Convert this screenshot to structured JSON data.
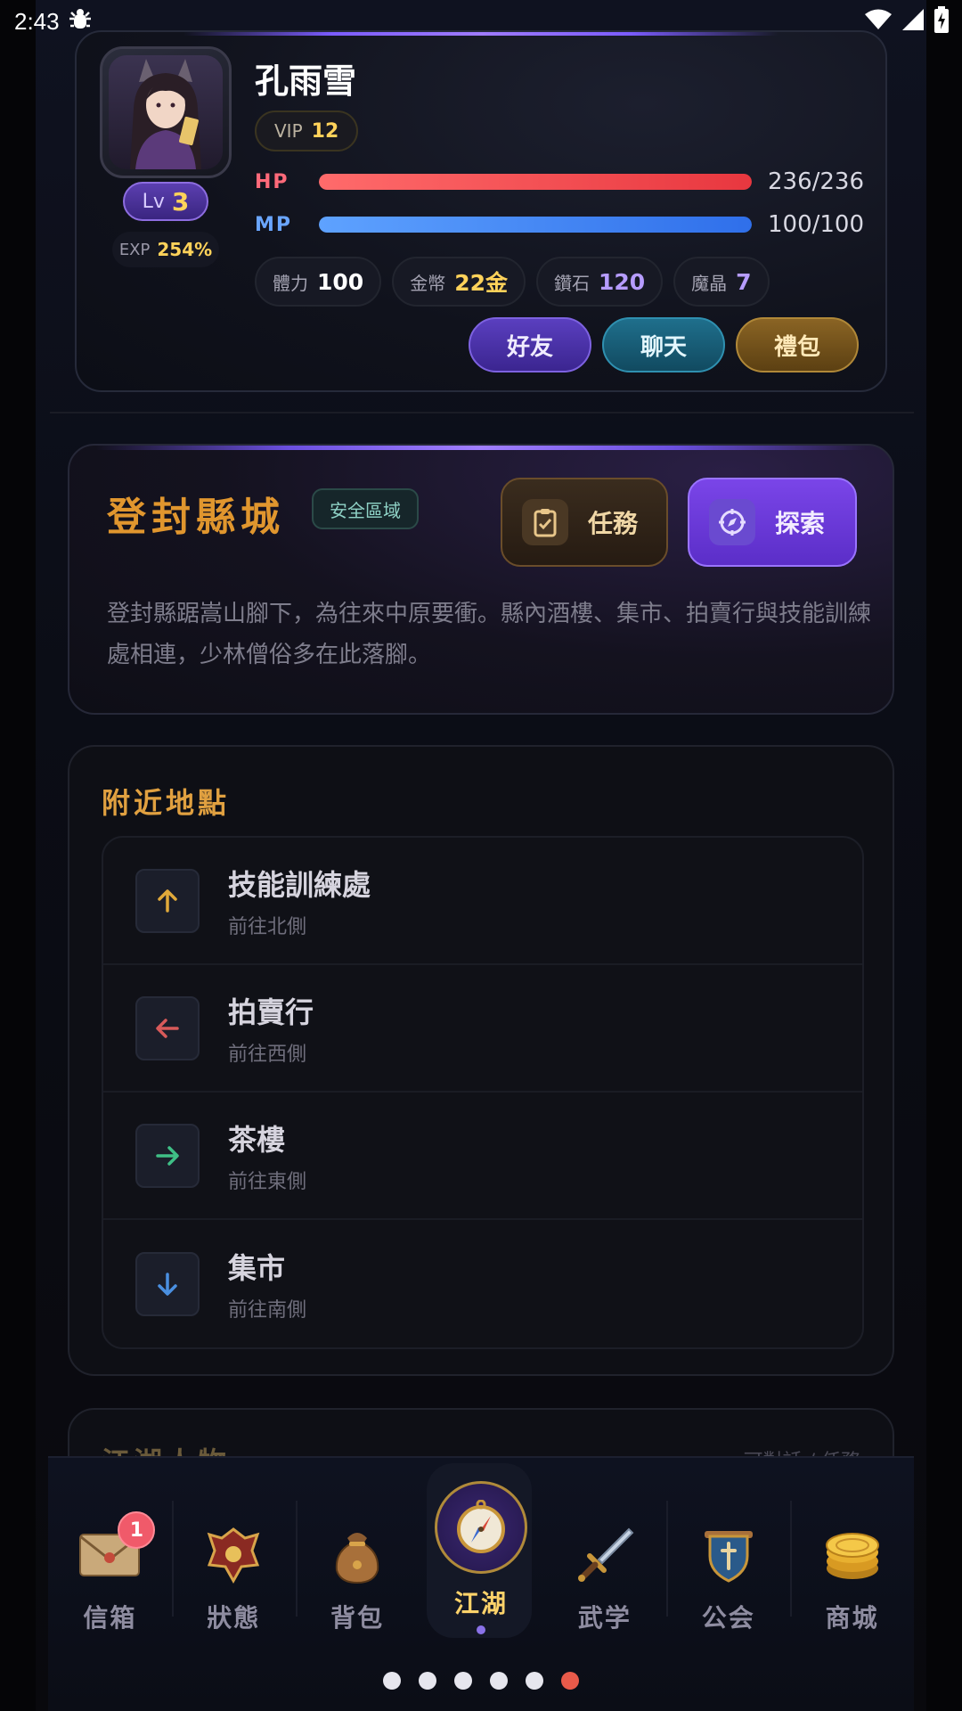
{
  "status_bar": {
    "time": "2:43"
  },
  "profile": {
    "name": "孔雨雪",
    "vip_label": "VIP",
    "vip_level": "12",
    "level_label": "Lv",
    "level": "3",
    "exp_label": "EXP",
    "exp_value": "254%",
    "hp": {
      "label": "HP",
      "value": "236/236",
      "fraction": 1.0,
      "color": "#e8373f"
    },
    "mp": {
      "label": "MP",
      "value": "100/100",
      "fraction": 1.0,
      "color": "#2f6fea"
    },
    "stats": [
      {
        "label": "體力",
        "value": "100",
        "color": "#ffffff"
      },
      {
        "label": "金幣",
        "value": "22金",
        "color": "#ffd25a"
      },
      {
        "label": "鑽石",
        "value": "120",
        "color": "#b69cff"
      },
      {
        "label": "魔晶",
        "value": "7",
        "color": "#b69cff"
      }
    ],
    "actions": {
      "friend": "好友",
      "chat": "聊天",
      "gift": "禮包"
    }
  },
  "location": {
    "title": "登封縣城",
    "badge": "安全區域",
    "task_label": "任務",
    "explore_label": "探索",
    "description": "登封縣踞嵩山腳下，為往來中原要衝。縣內酒樓、集市、拍賣行與技能訓練處相連，少林僧俗多在此落腳。"
  },
  "nearby": {
    "title": "附近地點",
    "items": [
      {
        "name": "技能訓練處",
        "direction": "前往北側",
        "icon": "arrow-up-icon",
        "color": "#e0a93a"
      },
      {
        "name": "拍賣行",
        "direction": "前往西側",
        "icon": "arrow-left-icon",
        "color": "#d85a5a"
      },
      {
        "name": "茶樓",
        "direction": "前往東側",
        "icon": "arrow-right-icon",
        "color": "#3fbf86"
      },
      {
        "name": "集市",
        "direction": "前往南側",
        "icon": "arrow-down-icon",
        "color": "#4a8fe0"
      }
    ]
  },
  "people": {
    "title": "江湖人物",
    "right": "可對話 / 任務"
  },
  "bottom_nav": {
    "items": [
      {
        "label": "信箱",
        "icon": "mail-icon",
        "badge": "1"
      },
      {
        "label": "狀態",
        "icon": "status-crest-icon"
      },
      {
        "label": "背包",
        "icon": "bag-icon"
      },
      {
        "label": "江湖",
        "icon": "compass-icon",
        "active": true
      },
      {
        "label": "武学",
        "icon": "sword-icon"
      },
      {
        "label": "公会",
        "icon": "guild-shield-icon"
      },
      {
        "label": "商城",
        "icon": "coin-stack-icon"
      }
    ]
  },
  "pager": {
    "count": 6,
    "active_index": 5
  }
}
